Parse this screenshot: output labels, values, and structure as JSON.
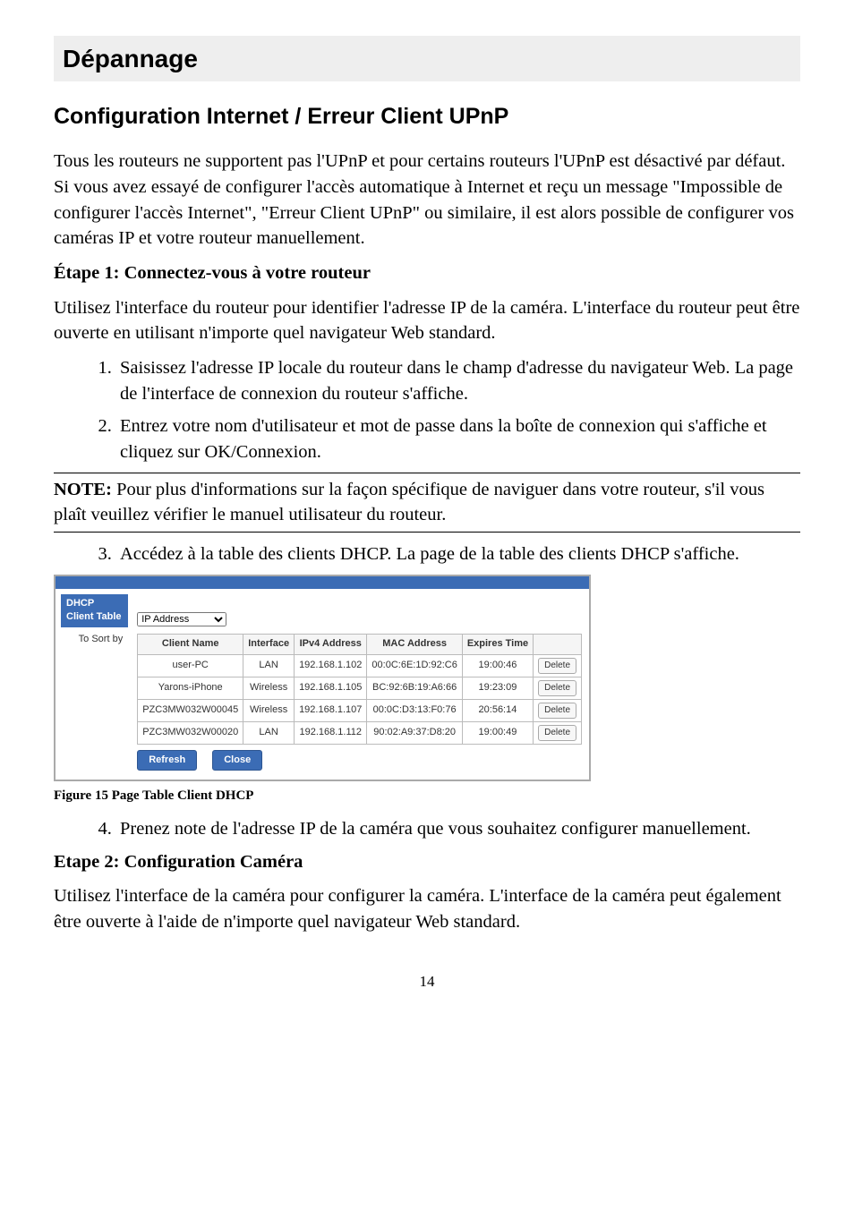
{
  "page_number": "14",
  "h1": "Dépannage",
  "h2": "Configuration Internet / Erreur Client UPnP",
  "intro_para": "Tous les routeurs ne supportent pas l'UPnP et pour certains routeurs l'UPnP est désactivé par défaut. Si vous avez essayé de configurer l'accès automatique à Internet et reçu un message \"Impossible de configurer l'accès Internet\", \"Erreur Client UPnP\" ou similaire, il est alors possible de configurer vos caméras IP et votre routeur manuellement.",
  "step1_head": "Étape 1: Connectez-vous à votre routeur",
  "step1_intro": "Utilisez l'interface du routeur pour identifier l'adresse IP de la caméra. L'interface du routeur peut être ouverte en utilisant n'importe quel navigateur Web standard.",
  "step1_item1": "Saisissez l'adresse IP locale du routeur dans le champ d'adresse du navigateur Web. La page de l'interface de connexion du routeur s'affiche.",
  "step1_item2": "Entrez votre nom d'utilisateur et mot de passe dans la boîte de connexion qui s'affiche et cliquez sur OK/Connexion.",
  "note_label": "NOTE:",
  "note_text": " Pour plus d'informations sur la façon spécifique de naviguer dans votre routeur, s'il vous plaît veuillez vérifier le manuel utilisateur du routeur.",
  "step1_item3": "Accédez à la table des clients DHCP. La page de la table des clients DHCP s'affiche.",
  "fig_caption": "Figure 15 Page Table Client DHCP",
  "step1_item4": "Prenez note de l'adresse IP de la caméra que vous souhaitez configurer manuellement.",
  "step2_head": "Etape 2: Configuration Caméra",
  "step2_intro": "Utilisez l'interface de la caméra pour configurer la caméra. L'interface de la caméra peut également être ouverte à l'aide de n'importe quel navigateur Web standard.",
  "dhcp": {
    "title": "DHCP Client Table",
    "sort_label": "To Sort by",
    "sort_value": "IP Address",
    "refresh": "Refresh",
    "close": "Close",
    "delete_label": "Delete",
    "headers": {
      "client": "Client Name",
      "iface": "Interface",
      "ipv4": "IPv4 Address",
      "mac": "MAC Address",
      "exp": "Expires Time"
    },
    "rows": [
      {
        "client": "user-PC",
        "iface": "LAN",
        "ipv4": "192.168.1.102",
        "mac": "00:0C:6E:1D:92:C6",
        "exp": "19:00:46"
      },
      {
        "client": "Yarons-iPhone",
        "iface": "Wireless",
        "ipv4": "192.168.1.105",
        "mac": "BC:92:6B:19:A6:66",
        "exp": "19:23:09"
      },
      {
        "client": "PZC3MW032W00045",
        "iface": "Wireless",
        "ipv4": "192.168.1.107",
        "mac": "00:0C:D3:13:F0:76",
        "exp": "20:56:14"
      },
      {
        "client": "PZC3MW032W00020",
        "iface": "LAN",
        "ipv4": "192.168.1.112",
        "mac": "90:02:A9:37:D8:20",
        "exp": "19:00:49"
      }
    ]
  }
}
